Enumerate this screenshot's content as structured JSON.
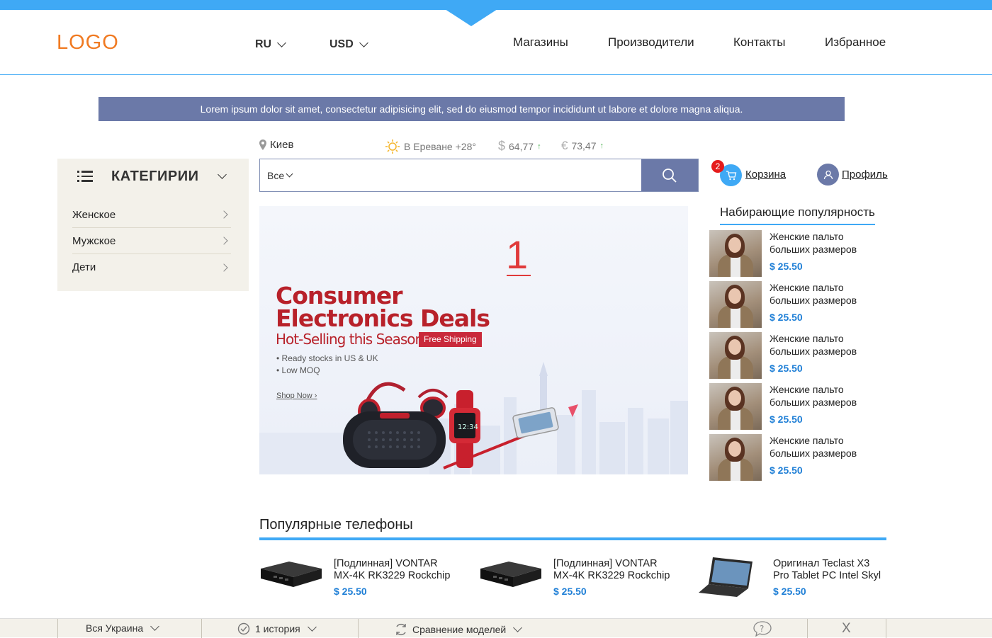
{
  "header": {
    "logo": "LOGO",
    "language": "RU",
    "currency": "USD",
    "nav": [
      "Магазины",
      "Производители",
      "Контакты",
      "Избранное"
    ]
  },
  "announcement": "Lorem ipsum dolor sit amet, consectetur adipisicing elit, sed do eiusmod tempor incididunt ut labore et dolore magna aliqua.",
  "info": {
    "city": "Киев",
    "weather": "В Ереване  +28°",
    "usd_rate": "64,77",
    "eur_rate": "73,47"
  },
  "categories": {
    "title": "КАТЕГИРИИ",
    "items": [
      "Женское",
      "Мужское",
      "Дети"
    ]
  },
  "search": {
    "scope": "Все",
    "placeholder": ""
  },
  "cart": {
    "label": "Корзина",
    "count": "2"
  },
  "profile": {
    "label": "Профиль"
  },
  "promo": {
    "slide_number": "1",
    "line1": "Consumer",
    "line2": "Electronics Deals",
    "subtitle": "Hot-Selling this Season",
    "tag": "Free Shipping",
    "bullet1": "• Ready stocks in US & UK",
    "bullet2": "• Low MOQ",
    "shop_now": "Shop Now ›"
  },
  "trending": {
    "title": "Набирающие популярность",
    "items": [
      {
        "name": "Женские пальто больших размеров",
        "price": "$ 25.50"
      },
      {
        "name": "Женские пальто больших размеров",
        "price": "$ 25.50"
      },
      {
        "name": "Женские пальто больших размеров",
        "price": "$ 25.50"
      },
      {
        "name": "Женские пальто больших размеров",
        "price": "$ 25.50"
      },
      {
        "name": "Женские пальто больших размеров",
        "price": "$ 25.50"
      }
    ]
  },
  "popular": {
    "title": "Популярные телефоны",
    "items": [
      {
        "name1": "[Подлинная] VONTAR",
        "name2": "MX-4K RK3229 Rockchip",
        "price": "$ 25.50"
      },
      {
        "name1": "[Подлинная] VONTAR",
        "name2": "MX-4K RK3229 Rockchip",
        "price": "$ 25.50"
      },
      {
        "name1": "Оригинал Teclast X3",
        "name2": "Pro Tablet PC Intel Skyl",
        "price": "$ 25.50"
      }
    ]
  },
  "footer": {
    "region": "Вся Украина",
    "history": "1 история",
    "compare": "Сравнение моделей",
    "close": "X"
  }
}
